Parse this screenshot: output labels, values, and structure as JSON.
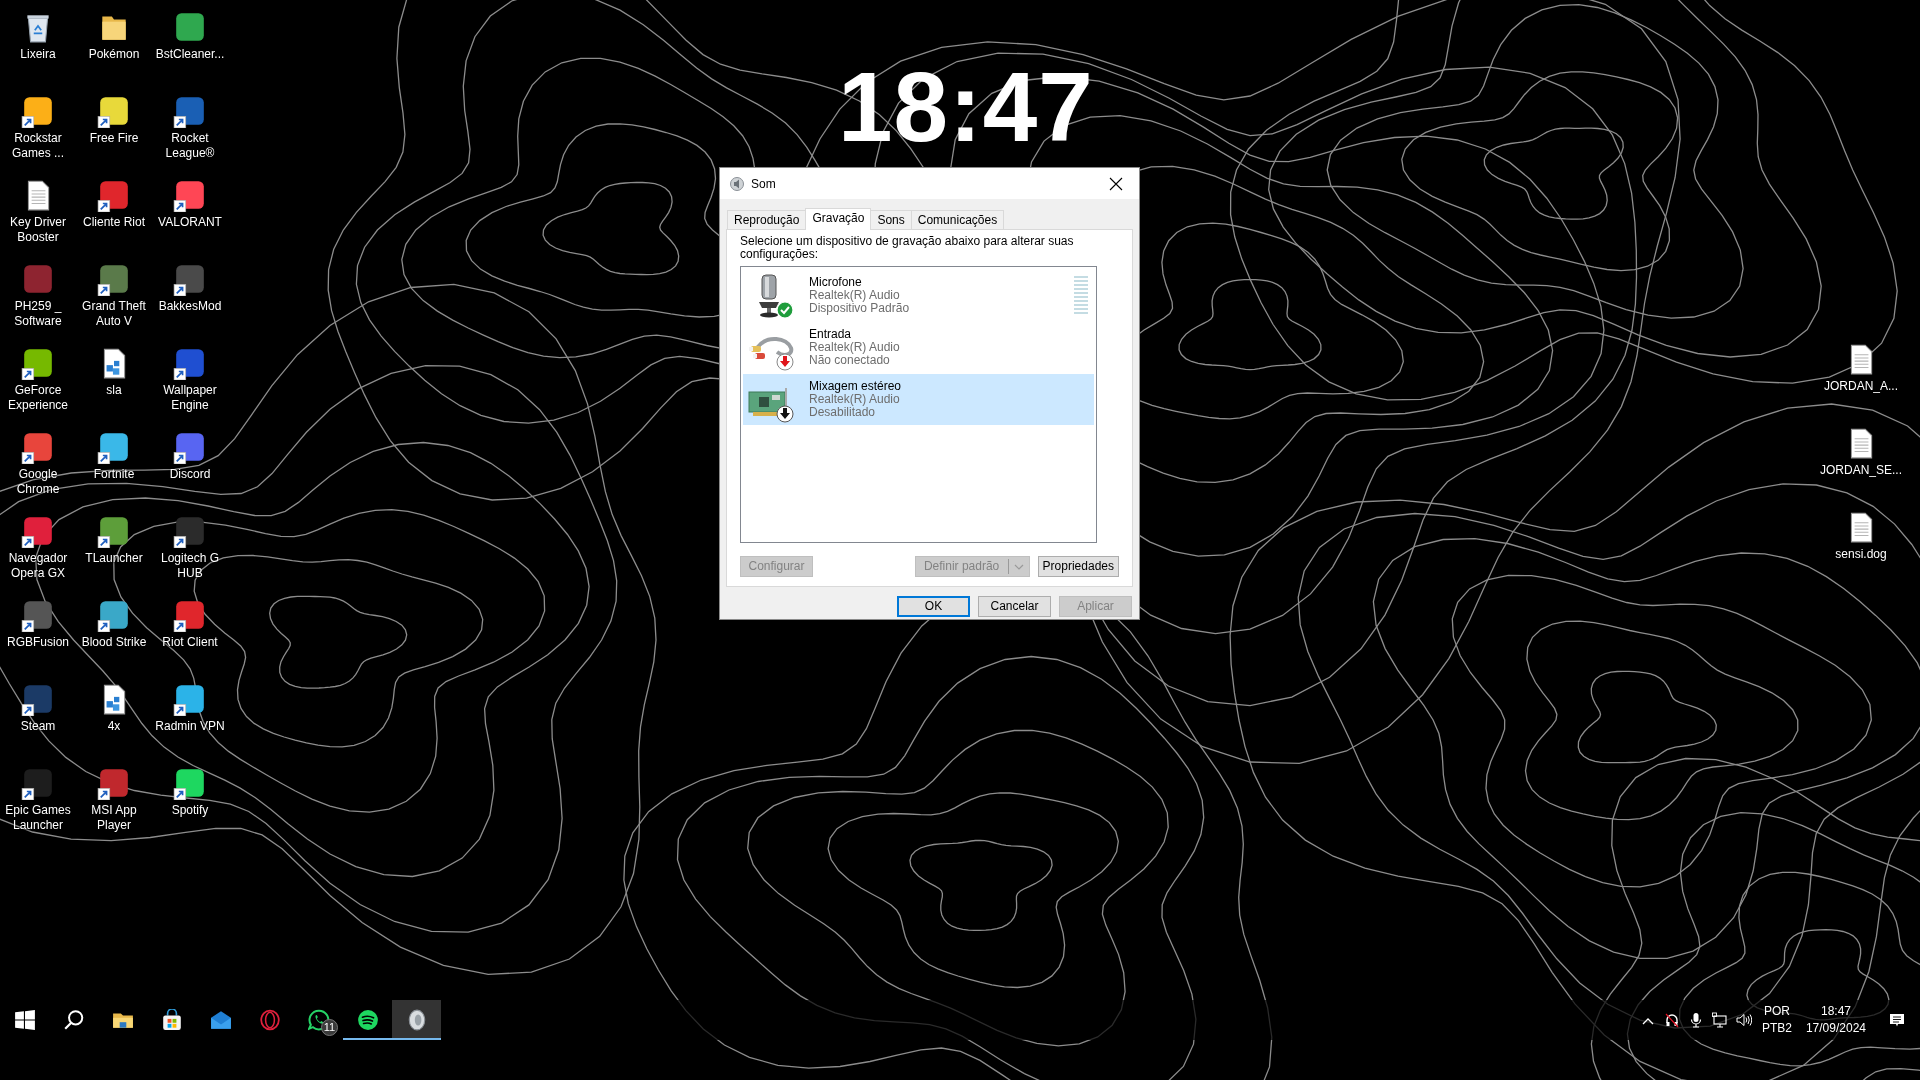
{
  "desktop_icons": [
    {
      "label": "Lixeira",
      "kind": "recycle-bin",
      "shortcut": false
    },
    {
      "label": "Pokémon",
      "kind": "folder",
      "shortcut": false
    },
    {
      "label": "BstCleaner...",
      "kind": "app",
      "color": "#2fa84f",
      "shortcut": false
    },
    {
      "label": "Rockstar Games ...",
      "kind": "app",
      "color": "#fcaf17",
      "shortcut": true
    },
    {
      "label": "Free Fire",
      "kind": "app",
      "color": "#e8d93a",
      "shortcut": true
    },
    {
      "label": "Rocket League®",
      "kind": "app",
      "color": "#1a5fb4",
      "shortcut": true
    },
    {
      "label": "Key Driver Booster",
      "kind": "document",
      "shortcut": false
    },
    {
      "label": "Cliente Riot",
      "kind": "app",
      "color": "#e0262c",
      "shortcut": true
    },
    {
      "label": "VALORANT",
      "kind": "app",
      "color": "#ff4655",
      "shortcut": true
    },
    {
      "label": "PH259 _ Software",
      "kind": "app",
      "color": "#8e2430",
      "shortcut": false
    },
    {
      "label": "Grand Theft Auto V",
      "kind": "app",
      "color": "#5a7a4a",
      "shortcut": true
    },
    {
      "label": "BakkesMod",
      "kind": "app",
      "color": "#4a4a4a",
      "shortcut": true
    },
    {
      "label": "GeForce Experience",
      "kind": "app",
      "color": "#76b900",
      "shortcut": true
    },
    {
      "label": "sla",
      "kind": "data-file",
      "shortcut": false
    },
    {
      "label": "Wallpaper Engine",
      "kind": "app",
      "color": "#1f4fd1",
      "shortcut": true
    },
    {
      "label": "Google Chrome",
      "kind": "app",
      "color": "#e8453c",
      "shortcut": true
    },
    {
      "label": "Fortnite",
      "kind": "app",
      "color": "#3ab8e8",
      "shortcut": true
    },
    {
      "label": "Discord",
      "kind": "app",
      "color": "#5865f2",
      "shortcut": true
    },
    {
      "label": "Navegador Opera GX",
      "kind": "app",
      "color": "#e0203c",
      "shortcut": true
    },
    {
      "label": "TLauncher",
      "kind": "app",
      "color": "#5d9e3a",
      "shortcut": true
    },
    {
      "label": "Logitech G HUB",
      "kind": "app",
      "color": "#2b2b2b",
      "shortcut": true
    },
    {
      "label": "RGBFusion",
      "kind": "app",
      "color": "#555555",
      "shortcut": true
    },
    {
      "label": "Blood Strike",
      "kind": "app",
      "color": "#3aa8c8",
      "shortcut": true
    },
    {
      "label": "Riot Client",
      "kind": "app",
      "color": "#e0262c",
      "shortcut": true
    },
    {
      "label": "Steam",
      "kind": "app",
      "color": "#1b3a66",
      "shortcut": true
    },
    {
      "label": "4x",
      "kind": "data-file",
      "shortcut": false
    },
    {
      "label": "Radmin VPN",
      "kind": "app",
      "color": "#2bb3e8",
      "shortcut": true
    },
    {
      "label": "Epic Games Launcher",
      "kind": "app",
      "color": "#1d1d1d",
      "shortcut": true
    },
    {
      "label": "MSI App Player",
      "kind": "app",
      "color": "#c0282d",
      "shortcut": true
    },
    {
      "label": "Spotify",
      "kind": "app",
      "color": "#1ed760",
      "shortcut": true
    }
  ],
  "desktop_icons_right": [
    {
      "label": "JORDAN_A...",
      "kind": "document",
      "shortcut": false
    },
    {
      "label": "JORDAN_SE...",
      "kind": "document",
      "shortcut": false
    },
    {
      "label": "sensi.dog",
      "kind": "document",
      "shortcut": false
    }
  ],
  "wallpaper_clock": "18:47",
  "dialog": {
    "title": "Som",
    "tabs": [
      {
        "label": "Reprodução",
        "selected": false
      },
      {
        "label": "Gravação",
        "selected": true
      },
      {
        "label": "Sons",
        "selected": false
      },
      {
        "label": "Comunicações",
        "selected": false
      }
    ],
    "instruction": "Selecione um dispositivo de gravação abaixo para alterar suas configurações:",
    "devices": [
      {
        "name": "Microfone",
        "driver": "Realtek(R) Audio",
        "status": "Dispositivo Padrão",
        "kind": "microphone",
        "default": true,
        "connected": true,
        "enabled": true,
        "selected": false,
        "level": 0
      },
      {
        "name": "Entrada",
        "driver": "Realtek(R) Audio",
        "status": "Não conectado",
        "kind": "cable",
        "default": false,
        "connected": false,
        "enabled": true,
        "selected": false
      },
      {
        "name": "Mixagem estéreo",
        "driver": "Realtek(R) Audio",
        "status": "Desabilitado",
        "kind": "card",
        "default": false,
        "connected": true,
        "enabled": false,
        "selected": true
      }
    ],
    "buttons": [
      {
        "label": "Configurar",
        "kind": "plain",
        "disabled": true
      },
      {
        "label": "Definir padrão",
        "kind": "split",
        "disabled": true
      },
      {
        "label": "Propriedades",
        "kind": "plain",
        "disabled": false
      }
    ],
    "footer_buttons": [
      {
        "label": "OK",
        "default": true,
        "disabled": false
      },
      {
        "label": "Cancelar",
        "default": false,
        "disabled": false
      },
      {
        "label": "Aplicar",
        "default": false,
        "disabled": true
      }
    ]
  },
  "taskbar": {
    "items": [
      {
        "kind": "start",
        "running": false,
        "selected": false
      },
      {
        "kind": "search",
        "running": false,
        "selected": false
      },
      {
        "kind": "explorer",
        "running": false,
        "selected": false
      },
      {
        "kind": "store",
        "running": false,
        "selected": false
      },
      {
        "kind": "mail",
        "running": false,
        "selected": false
      },
      {
        "kind": "opera",
        "running": false,
        "selected": false
      },
      {
        "kind": "whatsapp",
        "running": false,
        "selected": false,
        "badge": "11"
      },
      {
        "kind": "spotify",
        "running": true,
        "selected": false
      },
      {
        "kind": "sound",
        "running": true,
        "selected": true
      }
    ],
    "tray_icons": [
      {
        "kind": "chevron"
      },
      {
        "kind": "headset-muted"
      },
      {
        "kind": "microphone"
      },
      {
        "kind": "network"
      },
      {
        "kind": "volume"
      }
    ],
    "language": "POR",
    "keyboard": "PTB2",
    "time": "18:47",
    "date": "17/09/2024"
  }
}
